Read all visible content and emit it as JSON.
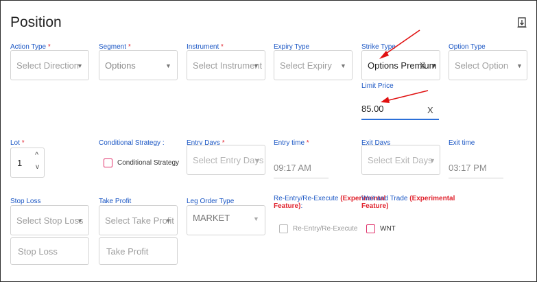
{
  "header": {
    "title": "Position",
    "corner_icon": "import-icon"
  },
  "row1": {
    "action_type": {
      "label": "Action Type",
      "required": "*",
      "placeholder": "Select Direction"
    },
    "segment": {
      "label": "Segment",
      "required": "*",
      "value": "Options"
    },
    "instrument": {
      "label": "Instrument",
      "required": "*",
      "placeholder": "Select Instrument"
    },
    "expiry_type": {
      "label": "Expiry Type",
      "placeholder": "Select Expiry"
    },
    "strike_type": {
      "label": "Strike Type",
      "value": "Options Premium",
      "clear": "X"
    },
    "option_type": {
      "label": "Option Type",
      "placeholder": "Select Option"
    }
  },
  "limit_price": {
    "label": "Limit Price",
    "value": "85.00",
    "clear": "X"
  },
  "row2": {
    "lot": {
      "label": "Lot",
      "required": "*",
      "value": "1"
    },
    "conditional": {
      "label": "Conditional Strategy :",
      "checkbox_label": "Conditional Strategy"
    },
    "entry_days": {
      "label": "Entry Days",
      "required": "*",
      "placeholder": "Select Entry Days"
    },
    "entry_time": {
      "label": "Entry time",
      "required": "*",
      "value": "09:17 AM"
    },
    "exit_days": {
      "label": "Exit Days",
      "placeholder": "Select Exit Days"
    },
    "exit_time": {
      "label": "Exit time",
      "value": "03:17 PM"
    }
  },
  "row3": {
    "stop_loss": {
      "label": "Stop Loss",
      "placeholder": "Select Stop Loss",
      "input_placeholder": "Stop Loss"
    },
    "take_profit": {
      "label": "Take Profit",
      "placeholder": "Select Take Profit",
      "input_placeholder": "Take Profit"
    },
    "leg_order_type": {
      "label": "Leg Order Type",
      "value": "MARKET"
    },
    "reentry": {
      "label": "Re-Entry/Re-Execute",
      "exp": "(Experimental",
      "exp2": "Feature)",
      "colon": ":",
      "checkbox_label": "Re-Entry/Re-Execute"
    },
    "wait_trade": {
      "label": "Wait and Trade",
      "exp": "(Experimental",
      "exp2": "Feature)",
      "checkbox_label": "WNT"
    }
  },
  "colors": {
    "label_blue": "#1a56c4",
    "required_red": "#e0222d",
    "checkbox_pink": "#e0306a",
    "focus_blue": "#2b6fd8",
    "arrow_red": "#e01010"
  }
}
